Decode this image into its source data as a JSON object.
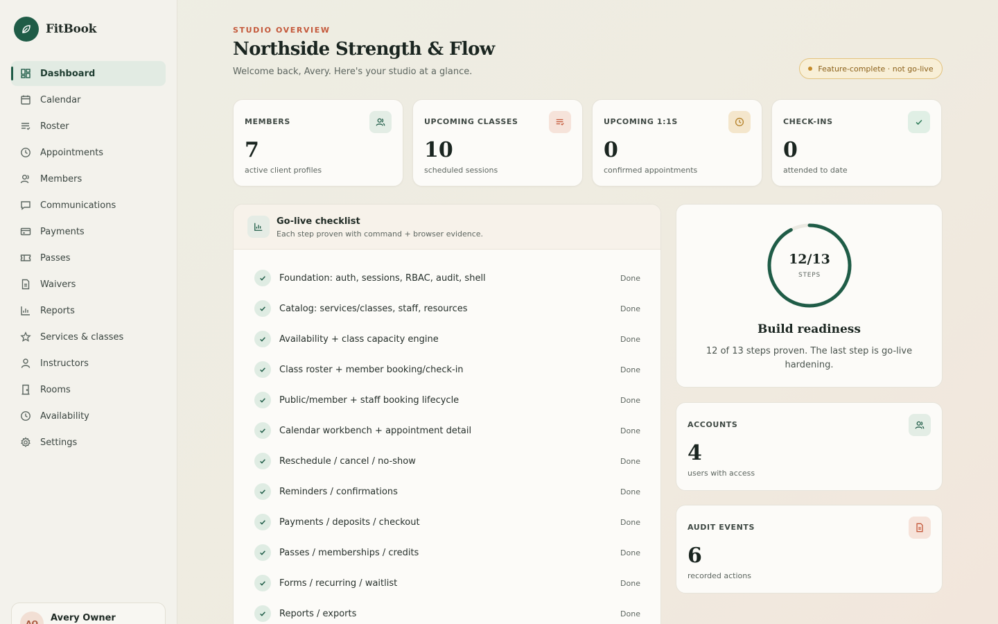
{
  "brand": {
    "name": "FitBook"
  },
  "sidebar": {
    "items": [
      {
        "label": "Dashboard",
        "icon": "dashboard-icon",
        "active": true
      },
      {
        "label": "Calendar",
        "icon": "calendar-icon"
      },
      {
        "label": "Roster",
        "icon": "roster-icon"
      },
      {
        "label": "Appointments",
        "icon": "clock-icon"
      },
      {
        "label": "Members",
        "icon": "user-icon"
      },
      {
        "label": "Communications",
        "icon": "message-icon"
      },
      {
        "label": "Payments",
        "icon": "card-icon"
      },
      {
        "label": "Passes",
        "icon": "ticket-icon"
      },
      {
        "label": "Waivers",
        "icon": "document-icon"
      },
      {
        "label": "Reports",
        "icon": "bar-chart-icon"
      },
      {
        "label": "Services & classes",
        "icon": "star-icon"
      },
      {
        "label": "Instructors",
        "icon": "person-icon"
      },
      {
        "label": "Rooms",
        "icon": "door-icon"
      },
      {
        "label": "Availability",
        "icon": "clock-icon"
      },
      {
        "label": "Settings",
        "icon": "gear-icon"
      }
    ],
    "user": {
      "initials": "AO",
      "name": "Avery Owner"
    }
  },
  "header": {
    "eyebrow": "STUDIO OVERVIEW",
    "title": "Northside Strength & Flow",
    "subtitle": "Welcome back, Avery. Here's your studio at a glance.",
    "badge": "Feature-complete · not go-live"
  },
  "stats": [
    {
      "label": "MEMBERS",
      "value": "7",
      "caption": "active client profiles",
      "icon": "users-icon"
    },
    {
      "label": "UPCOMING CLASSES",
      "value": "10",
      "caption": "scheduled sessions",
      "icon": "list-icon"
    },
    {
      "label": "UPCOMING 1:1S",
      "value": "0",
      "caption": "confirmed appointments",
      "icon": "clock-icon"
    },
    {
      "label": "CHECK-INS",
      "value": "0",
      "caption": "attended to date",
      "icon": "check-icon"
    }
  ],
  "checklist": {
    "title": "Go-live checklist",
    "subtitle": "Each step proven with command + browser evidence.",
    "items": [
      {
        "label": "Foundation: auth, sessions, RBAC, audit, shell",
        "status": "Done"
      },
      {
        "label": "Catalog: services/classes, staff, resources",
        "status": "Done"
      },
      {
        "label": "Availability + class capacity engine",
        "status": "Done"
      },
      {
        "label": "Class roster + member booking/check-in",
        "status": "Done"
      },
      {
        "label": "Public/member + staff booking lifecycle",
        "status": "Done"
      },
      {
        "label": "Calendar workbench + appointment detail",
        "status": "Done"
      },
      {
        "label": "Reschedule / cancel / no-show",
        "status": "Done"
      },
      {
        "label": "Reminders / confirmations",
        "status": "Done"
      },
      {
        "label": "Payments / deposits / checkout",
        "status": "Done"
      },
      {
        "label": "Passes / memberships / credits",
        "status": "Done"
      },
      {
        "label": "Forms / recurring / waitlist",
        "status": "Done"
      },
      {
        "label": "Reports / exports",
        "status": "Done"
      }
    ]
  },
  "readiness": {
    "value": "12/13",
    "label": "STEPS",
    "completed": 12,
    "total": 13,
    "title": "Build readiness",
    "description": "12 of 13 steps proven. The last step is go-live hardening."
  },
  "accounts": {
    "label": "ACCOUNTS",
    "value": "4",
    "caption": "users with access",
    "icon": "users-icon"
  },
  "audit": {
    "label": "AUDIT EVENTS",
    "value": "6",
    "caption": "recorded actions",
    "icon": "document-icon"
  },
  "colors": {
    "accent": "#1f5c47",
    "coral": "#c4583a",
    "amber": "#b5822a"
  }
}
